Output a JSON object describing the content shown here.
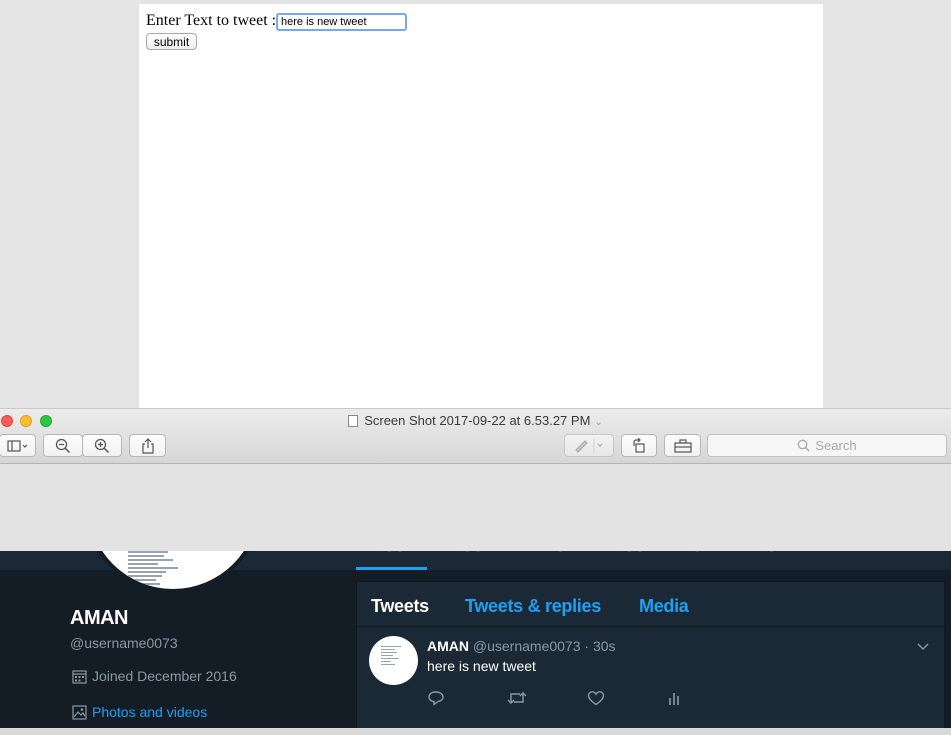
{
  "web_form": {
    "label": "Enter Text to tweet :",
    "input_value": "here is new tweet",
    "submit_label": "submit"
  },
  "preview_window": {
    "title": "Screen Shot 2017-09-22 at 6.53.27 PM",
    "search_placeholder": "Search"
  },
  "profile": {
    "name": "AMAN",
    "handle": "@username0073",
    "joined": "Joined December 2016",
    "photos_link": "Photos and videos"
  },
  "timeline": {
    "tabs": [
      {
        "label": "Tweets",
        "active": true
      },
      {
        "label": "Tweets & replies",
        "active": false
      },
      {
        "label": "Media",
        "active": false
      }
    ],
    "tweet": {
      "name": "AMAN",
      "handle": "@username0073",
      "time": "· 30s",
      "text": "here is new tweet"
    }
  },
  "colors": {
    "twitter_blue": "#1da1f2",
    "dark_bg": "#141d26",
    "panel_bg": "#1b2836",
    "muted_text": "#8899a6"
  },
  "icons": [
    "document-icon",
    "sidebar-icon",
    "zoom-out-icon",
    "zoom-in-icon",
    "share-icon",
    "markup-pen-icon",
    "rotate-icon",
    "toolbox-icon",
    "search-icon",
    "calendar-icon",
    "photo-icon",
    "reply-icon",
    "retweet-icon",
    "like-icon",
    "analytics-icon",
    "chevron-down-icon"
  ]
}
